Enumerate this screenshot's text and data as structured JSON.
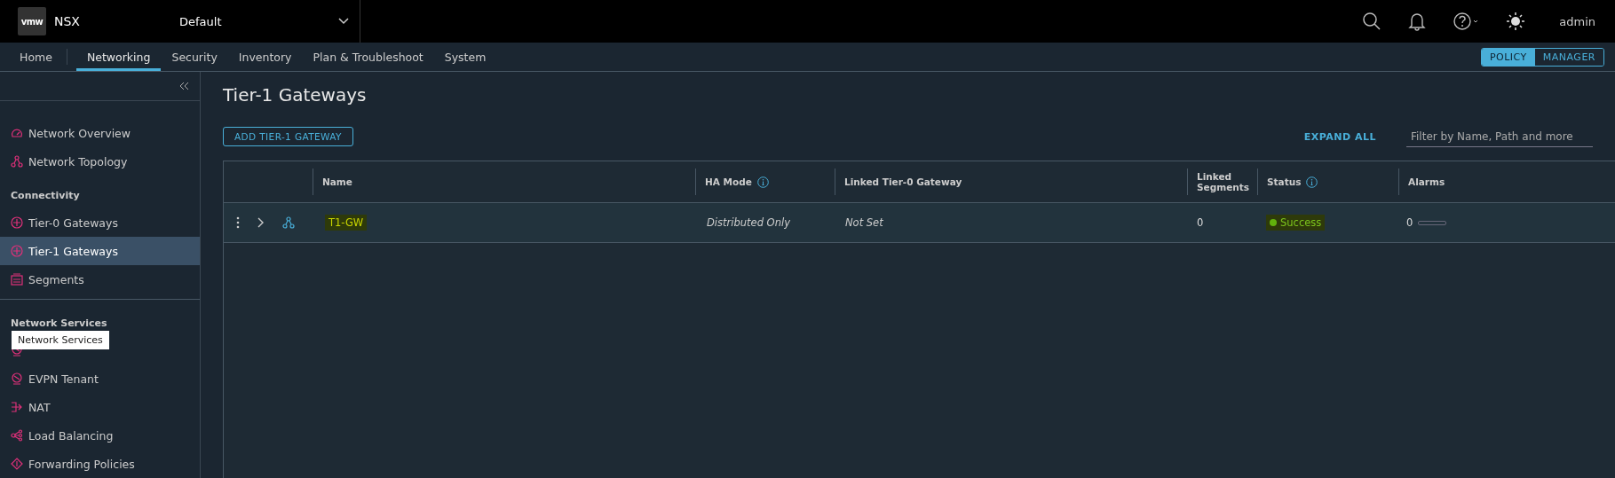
{
  "header": {
    "logo": "vmw",
    "product": "NSX",
    "project": "Default",
    "user": "admin"
  },
  "nav": {
    "tabs": [
      {
        "label": "Home",
        "selected": false
      },
      {
        "label": "Networking",
        "selected": true
      },
      {
        "label": "Security",
        "selected": false
      },
      {
        "label": "Inventory",
        "selected": false
      },
      {
        "label": "Plan & Troubleshoot",
        "selected": false
      },
      {
        "label": "System",
        "selected": false
      }
    ],
    "modes": [
      {
        "label": "POLICY",
        "selected": true
      },
      {
        "label": "MANAGER",
        "selected": false
      }
    ]
  },
  "sidebar": {
    "sections": [
      {
        "items": [
          {
            "label": "Network Overview",
            "selected": false
          },
          {
            "label": "Network Topology",
            "selected": false
          }
        ]
      },
      {
        "title": "Connectivity",
        "items": [
          {
            "label": "Tier-0 Gateways",
            "selected": false
          },
          {
            "label": "Tier-1 Gateways",
            "selected": true
          },
          {
            "label": "Segments",
            "selected": false
          }
        ]
      },
      {
        "title": "Network Services",
        "items": [
          {
            "selected": false
          },
          {
            "label": "EVPN Tenant",
            "selected": false
          },
          {
            "label": "NAT",
            "selected": false
          },
          {
            "label": "Load Balancing",
            "selected": false
          },
          {
            "label": "Forwarding Policies",
            "selected": false
          }
        ]
      }
    ],
    "tooltip": "Network Services"
  },
  "page": {
    "title": "Tier-1 Gateways",
    "add_button": "ADD TIER-1 GATEWAY",
    "expand_all": "EXPAND ALL",
    "filter": {
      "placeholder": "Filter by Name, Path and more"
    }
  },
  "table": {
    "columns": [
      {
        "label": "Name"
      },
      {
        "label": "HA Mode",
        "info": true
      },
      {
        "label": "Linked Tier-0 Gateway"
      },
      {
        "label": "Linked Segments"
      },
      {
        "label": "Status",
        "info": true
      },
      {
        "label": "Alarms"
      }
    ],
    "rows": [
      {
        "name": "T1-GW",
        "name_highlighted": true,
        "ha_mode": "Distributed Only",
        "linked_tier0": "Not Set",
        "linked_segments": "0",
        "status": "Success",
        "status_highlighted": true,
        "alarms": "0"
      }
    ]
  }
}
